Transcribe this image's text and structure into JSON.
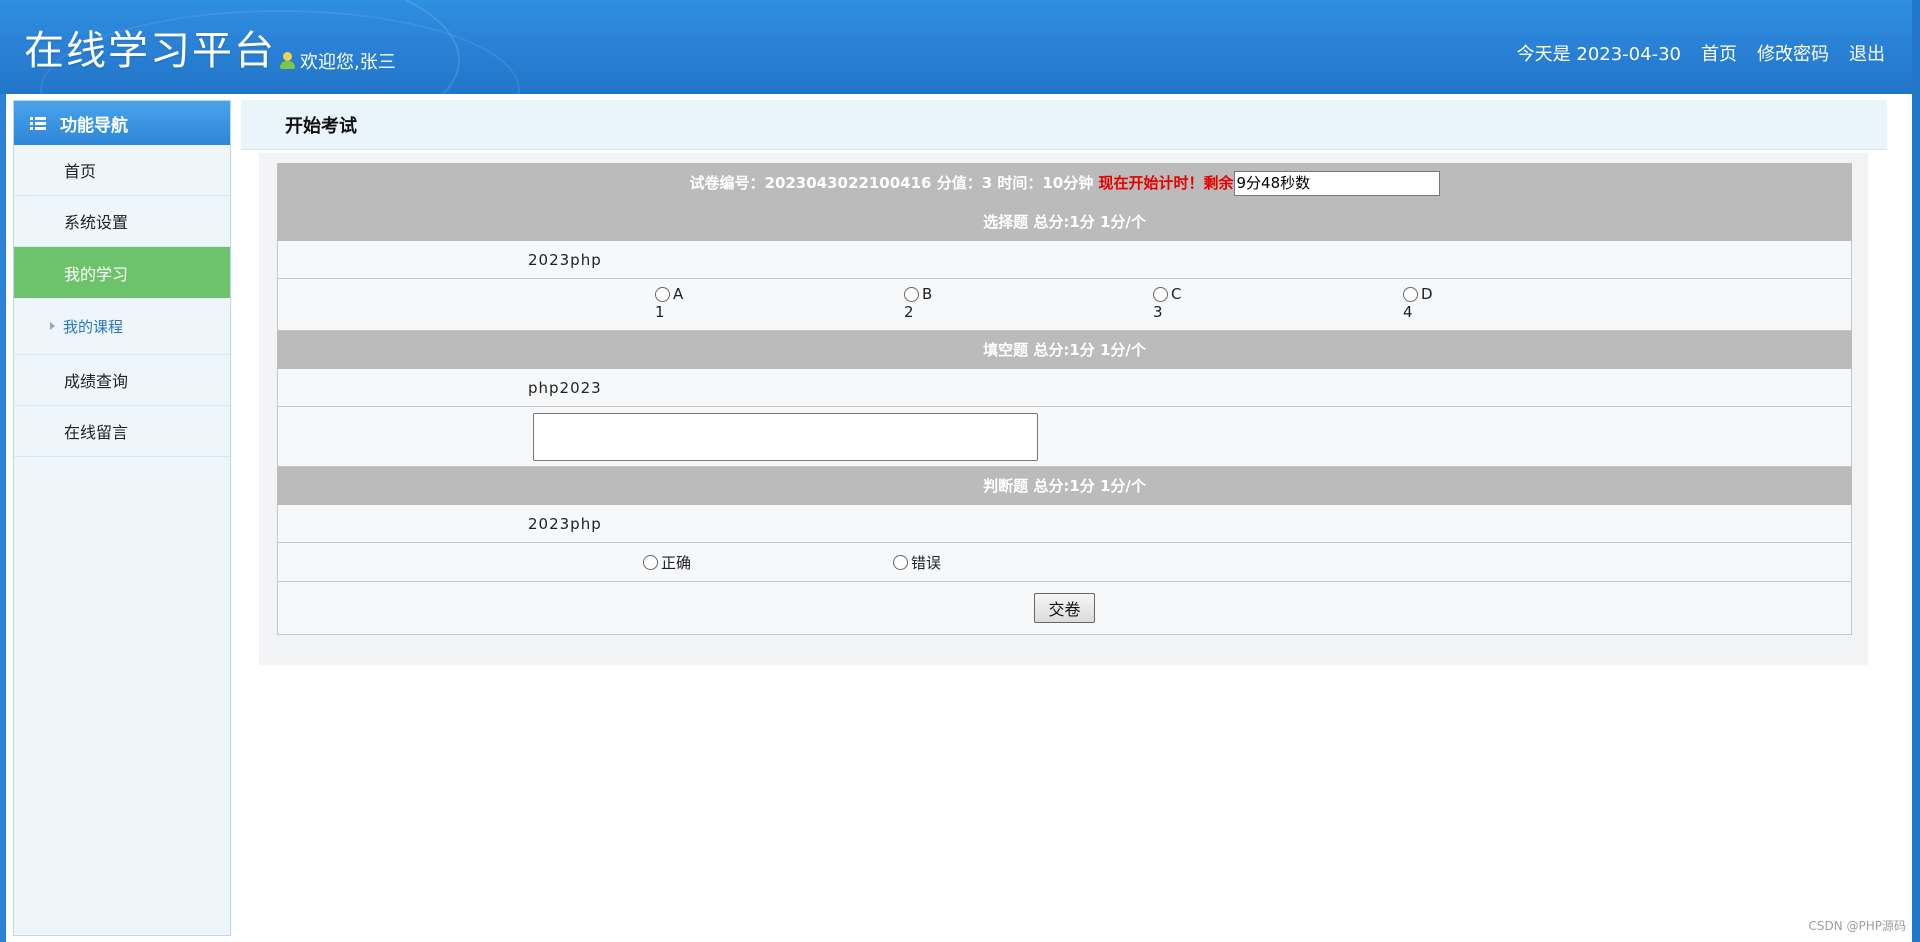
{
  "header": {
    "logo": "在线学习平台",
    "welcome": "欢迎您,张三",
    "date_text": "今天是 2023-04-30",
    "nav": [
      "首页",
      "修改密码",
      "退出"
    ]
  },
  "sidebar": {
    "title": "功能导航",
    "items": [
      {
        "label": "首页"
      },
      {
        "label": "系统设置"
      },
      {
        "label": "我的学习",
        "active": true
      },
      {
        "label": "我的课程",
        "sub": true
      },
      {
        "label": "成绩查询"
      },
      {
        "label": "在线留言"
      }
    ]
  },
  "page": {
    "title": "开始考试"
  },
  "exam": {
    "info": "试卷编号：2023043022100416 分值：3 时间：10分钟",
    "timer_label": "现在开始计时！剩余",
    "timer_value": "9分48秒数",
    "sections": {
      "choice": {
        "title": "选择题 总分:1分 1分/个",
        "question": "2023php",
        "options": [
          {
            "letter": "A",
            "text": "1"
          },
          {
            "letter": "B",
            "text": "2"
          },
          {
            "letter": "C",
            "text": "3"
          },
          {
            "letter": "D",
            "text": "4"
          }
        ]
      },
      "fill": {
        "title": "填空题 总分:1分 1分/个",
        "question": "php2023",
        "answer": ""
      },
      "judge": {
        "title": "判断题 总分:1分 1分/个",
        "question": "2023php",
        "options": [
          "正确",
          "错误"
        ]
      }
    },
    "submit_label": "交卷"
  },
  "watermark": "CSDN @PHP源码",
  "colors": {
    "header_blue": "#2a82d6",
    "active_green": "#6cc36b",
    "section_gray": "#bbbbbb",
    "timer_red": "#e60000"
  }
}
